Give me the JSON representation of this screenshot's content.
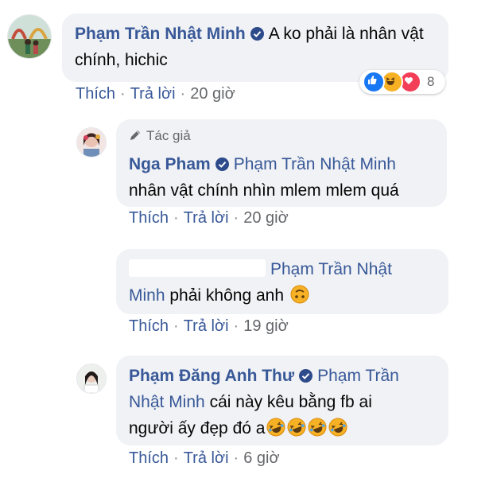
{
  "comments": [
    {
      "name": "Phạm Trần Nhật Minh",
      "text": "A ko phải là nhân vật chính, hichic",
      "actions": {
        "like": "Thích",
        "reply": "Trả lời",
        "time": "20 giờ"
      },
      "reaction_count": "8"
    },
    {
      "author_badge": "Tác giả",
      "name": "Nga Pham",
      "mention": "Phạm Trần Nhật Minh",
      "text": "nhân vật chính nhìn mlem mlem quá",
      "actions": {
        "like": "Thích",
        "reply": "Trả lời",
        "time": "20 giờ"
      }
    },
    {
      "mention_line1": "Phạm Trần Nhật",
      "mention_line2": "Minh",
      "text": "phải không anh",
      "actions": {
        "like": "Thích",
        "reply": "Trả lời",
        "time": "19 giờ"
      }
    },
    {
      "name": "Phạm Đăng Anh Thư",
      "mention_line1": "Phạm Trần",
      "mention_line2": "Nhật Minh",
      "text_line2": "cái này kêu bằng fb ai",
      "text_line3": "người ấy đẹp đó a",
      "actions": {
        "like": "Thích",
        "reply": "Trả lời",
        "time": "6 giờ"
      }
    }
  ],
  "colors": {
    "link": "#385898",
    "bubble": "#f0f2f5",
    "meta": "#65676b",
    "verified": "#2d4a8a"
  },
  "icons": [
    "verified-badge-icon",
    "pen-icon",
    "like-reaction-icon",
    "haha-reaction-icon",
    "love-reaction-icon",
    "upside-down-face-emoji",
    "rofl-emoji"
  ]
}
